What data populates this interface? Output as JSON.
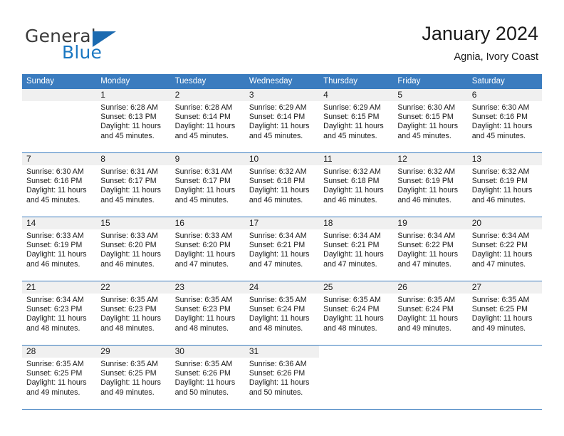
{
  "brand": {
    "word_one": "General",
    "word_two": "Blue",
    "triangle_icon": "blue-triangle-logo-mark",
    "colors": {
      "general": "#3b3b3b",
      "blue": "#1b78c2",
      "triangle": "#1b6ab0"
    }
  },
  "header": {
    "title": "January 2024",
    "subtitle": "Agnia, Ivory Coast"
  },
  "theme": {
    "header_bar": "#3b7cbf",
    "daynum_band": "#f0f0f0",
    "text": "#1a1a1a",
    "page_bg": "#ffffff"
  },
  "weekdays": [
    "Sunday",
    "Monday",
    "Tuesday",
    "Wednesday",
    "Thursday",
    "Friday",
    "Saturday"
  ],
  "weeks": [
    [
      {
        "blank": true
      },
      {
        "day": "1",
        "sunrise": "Sunrise: 6:28 AM",
        "sunset": "Sunset: 6:13 PM",
        "daylight1": "Daylight: 11 hours",
        "daylight2": "and 45 minutes."
      },
      {
        "day": "2",
        "sunrise": "Sunrise: 6:28 AM",
        "sunset": "Sunset: 6:14 PM",
        "daylight1": "Daylight: 11 hours",
        "daylight2": "and 45 minutes."
      },
      {
        "day": "3",
        "sunrise": "Sunrise: 6:29 AM",
        "sunset": "Sunset: 6:14 PM",
        "daylight1": "Daylight: 11 hours",
        "daylight2": "and 45 minutes."
      },
      {
        "day": "4",
        "sunrise": "Sunrise: 6:29 AM",
        "sunset": "Sunset: 6:15 PM",
        "daylight1": "Daylight: 11 hours",
        "daylight2": "and 45 minutes."
      },
      {
        "day": "5",
        "sunrise": "Sunrise: 6:30 AM",
        "sunset": "Sunset: 6:15 PM",
        "daylight1": "Daylight: 11 hours",
        "daylight2": "and 45 minutes."
      },
      {
        "day": "6",
        "sunrise": "Sunrise: 6:30 AM",
        "sunset": "Sunset: 6:16 PM",
        "daylight1": "Daylight: 11 hours",
        "daylight2": "and 45 minutes."
      }
    ],
    [
      {
        "day": "7",
        "sunrise": "Sunrise: 6:30 AM",
        "sunset": "Sunset: 6:16 PM",
        "daylight1": "Daylight: 11 hours",
        "daylight2": "and 45 minutes."
      },
      {
        "day": "8",
        "sunrise": "Sunrise: 6:31 AM",
        "sunset": "Sunset: 6:17 PM",
        "daylight1": "Daylight: 11 hours",
        "daylight2": "and 45 minutes."
      },
      {
        "day": "9",
        "sunrise": "Sunrise: 6:31 AM",
        "sunset": "Sunset: 6:17 PM",
        "daylight1": "Daylight: 11 hours",
        "daylight2": "and 45 minutes."
      },
      {
        "day": "10",
        "sunrise": "Sunrise: 6:32 AM",
        "sunset": "Sunset: 6:18 PM",
        "daylight1": "Daylight: 11 hours",
        "daylight2": "and 46 minutes."
      },
      {
        "day": "11",
        "sunrise": "Sunrise: 6:32 AM",
        "sunset": "Sunset: 6:18 PM",
        "daylight1": "Daylight: 11 hours",
        "daylight2": "and 46 minutes."
      },
      {
        "day": "12",
        "sunrise": "Sunrise: 6:32 AM",
        "sunset": "Sunset: 6:19 PM",
        "daylight1": "Daylight: 11 hours",
        "daylight2": "and 46 minutes."
      },
      {
        "day": "13",
        "sunrise": "Sunrise: 6:32 AM",
        "sunset": "Sunset: 6:19 PM",
        "daylight1": "Daylight: 11 hours",
        "daylight2": "and 46 minutes."
      }
    ],
    [
      {
        "day": "14",
        "sunrise": "Sunrise: 6:33 AM",
        "sunset": "Sunset: 6:19 PM",
        "daylight1": "Daylight: 11 hours",
        "daylight2": "and 46 minutes."
      },
      {
        "day": "15",
        "sunrise": "Sunrise: 6:33 AM",
        "sunset": "Sunset: 6:20 PM",
        "daylight1": "Daylight: 11 hours",
        "daylight2": "and 46 minutes."
      },
      {
        "day": "16",
        "sunrise": "Sunrise: 6:33 AM",
        "sunset": "Sunset: 6:20 PM",
        "daylight1": "Daylight: 11 hours",
        "daylight2": "and 47 minutes."
      },
      {
        "day": "17",
        "sunrise": "Sunrise: 6:34 AM",
        "sunset": "Sunset: 6:21 PM",
        "daylight1": "Daylight: 11 hours",
        "daylight2": "and 47 minutes."
      },
      {
        "day": "18",
        "sunrise": "Sunrise: 6:34 AM",
        "sunset": "Sunset: 6:21 PM",
        "daylight1": "Daylight: 11 hours",
        "daylight2": "and 47 minutes."
      },
      {
        "day": "19",
        "sunrise": "Sunrise: 6:34 AM",
        "sunset": "Sunset: 6:22 PM",
        "daylight1": "Daylight: 11 hours",
        "daylight2": "and 47 minutes."
      },
      {
        "day": "20",
        "sunrise": "Sunrise: 6:34 AM",
        "sunset": "Sunset: 6:22 PM",
        "daylight1": "Daylight: 11 hours",
        "daylight2": "and 47 minutes."
      }
    ],
    [
      {
        "day": "21",
        "sunrise": "Sunrise: 6:34 AM",
        "sunset": "Sunset: 6:23 PM",
        "daylight1": "Daylight: 11 hours",
        "daylight2": "and 48 minutes."
      },
      {
        "day": "22",
        "sunrise": "Sunrise: 6:35 AM",
        "sunset": "Sunset: 6:23 PM",
        "daylight1": "Daylight: 11 hours",
        "daylight2": "and 48 minutes."
      },
      {
        "day": "23",
        "sunrise": "Sunrise: 6:35 AM",
        "sunset": "Sunset: 6:23 PM",
        "daylight1": "Daylight: 11 hours",
        "daylight2": "and 48 minutes."
      },
      {
        "day": "24",
        "sunrise": "Sunrise: 6:35 AM",
        "sunset": "Sunset: 6:24 PM",
        "daylight1": "Daylight: 11 hours",
        "daylight2": "and 48 minutes."
      },
      {
        "day": "25",
        "sunrise": "Sunrise: 6:35 AM",
        "sunset": "Sunset: 6:24 PM",
        "daylight1": "Daylight: 11 hours",
        "daylight2": "and 48 minutes."
      },
      {
        "day": "26",
        "sunrise": "Sunrise: 6:35 AM",
        "sunset": "Sunset: 6:24 PM",
        "daylight1": "Daylight: 11 hours",
        "daylight2": "and 49 minutes."
      },
      {
        "day": "27",
        "sunrise": "Sunrise: 6:35 AM",
        "sunset": "Sunset: 6:25 PM",
        "daylight1": "Daylight: 11 hours",
        "daylight2": "and 49 minutes."
      }
    ],
    [
      {
        "day": "28",
        "sunrise": "Sunrise: 6:35 AM",
        "sunset": "Sunset: 6:25 PM",
        "daylight1": "Daylight: 11 hours",
        "daylight2": "and 49 minutes."
      },
      {
        "day": "29",
        "sunrise": "Sunrise: 6:35 AM",
        "sunset": "Sunset: 6:25 PM",
        "daylight1": "Daylight: 11 hours",
        "daylight2": "and 49 minutes."
      },
      {
        "day": "30",
        "sunrise": "Sunrise: 6:35 AM",
        "sunset": "Sunset: 6:26 PM",
        "daylight1": "Daylight: 11 hours",
        "daylight2": "and 50 minutes."
      },
      {
        "day": "31",
        "sunrise": "Sunrise: 6:36 AM",
        "sunset": "Sunset: 6:26 PM",
        "daylight1": "Daylight: 11 hours",
        "daylight2": "and 50 minutes."
      },
      {
        "blank": true
      },
      {
        "blank": true
      },
      {
        "blank": true
      }
    ]
  ]
}
